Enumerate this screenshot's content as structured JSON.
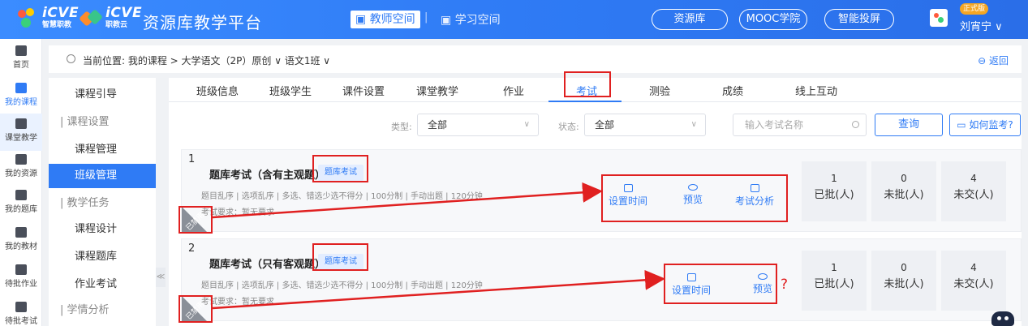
{
  "header": {
    "brand1": {
      "big": "iCVE",
      "small": "智慧职教"
    },
    "brand2": {
      "big": "iCVE",
      "small": "职教云"
    },
    "platform_title": "资源库教学平台",
    "nav_teacher": "教师空间",
    "nav_separator": "|",
    "nav_student": "学习空间",
    "buttons": [
      "资源库",
      "MOOC学院",
      "智能投屏"
    ],
    "badge": "正式版",
    "user_name": "刘宵宁 ∨"
  },
  "rail": {
    "items": [
      "首页",
      "我的课程",
      "课堂教学",
      "我的资源",
      "我的题库",
      "我的教材",
      "待批作业",
      "待批考试"
    ]
  },
  "breadcrumb": {
    "text": "当前位置: 我的课程 > 大学语文（2P）原创 ∨  语文1班 ∨",
    "back": "返回"
  },
  "sidebar": {
    "items": [
      "课程引导",
      "课程设置",
      "课程管理",
      "班级管理",
      "教学任务",
      "课程设计",
      "课程题库",
      "作业考试",
      "学情分析"
    ]
  },
  "tabs": [
    "班级信息",
    "班级学生",
    "课件设置",
    "课堂教学",
    "作业",
    "考试",
    "测验",
    "成绩",
    "线上互动"
  ],
  "filters": {
    "type_label": "类型:",
    "type_value": "全部",
    "status_label": "状态:",
    "status_value": "全部",
    "search_placeholder": "输入考试名称",
    "query_button": "查询",
    "monitor_button": "如何监考?"
  },
  "exams": [
    {
      "index": "1",
      "title": "题库考试（含有主观题）",
      "tag": "题库考试",
      "meta": "题目乱序 | 选项乱序 | 多选、错选少选不得分 | 100分制 | 手动出题 | 120分钟",
      "requirement": "考试要求：暂无要求",
      "ribbon": "已禁用",
      "actions": [
        "设置时间",
        "预览",
        "考试分析"
      ],
      "stats": [
        {
          "num": "1",
          "label": "已批(人)"
        },
        {
          "num": "0",
          "label": "未批(人)"
        },
        {
          "num": "4",
          "label": "未交(人)"
        }
      ]
    },
    {
      "index": "2",
      "title": "题库考试（只有客观题）",
      "tag": "题库考试",
      "meta": "题目乱序 | 选项乱序 | 多选、错选少选不得分 | 100分制 | 手动出题 | 120分钟",
      "requirement": "考试要求：暂无要求",
      "ribbon": "已禁用",
      "actions": [
        "设置时间",
        "预览"
      ],
      "stats": [
        {
          "num": "1",
          "label": "已批(人)"
        },
        {
          "num": "0",
          "label": "未批(人)"
        },
        {
          "num": "4",
          "label": "未交(人)"
        }
      ]
    }
  ],
  "annotation": {
    "question_mark": "?"
  },
  "colors": {
    "primary": "#2f7bf5",
    "annotation_red": "#e02020"
  }
}
